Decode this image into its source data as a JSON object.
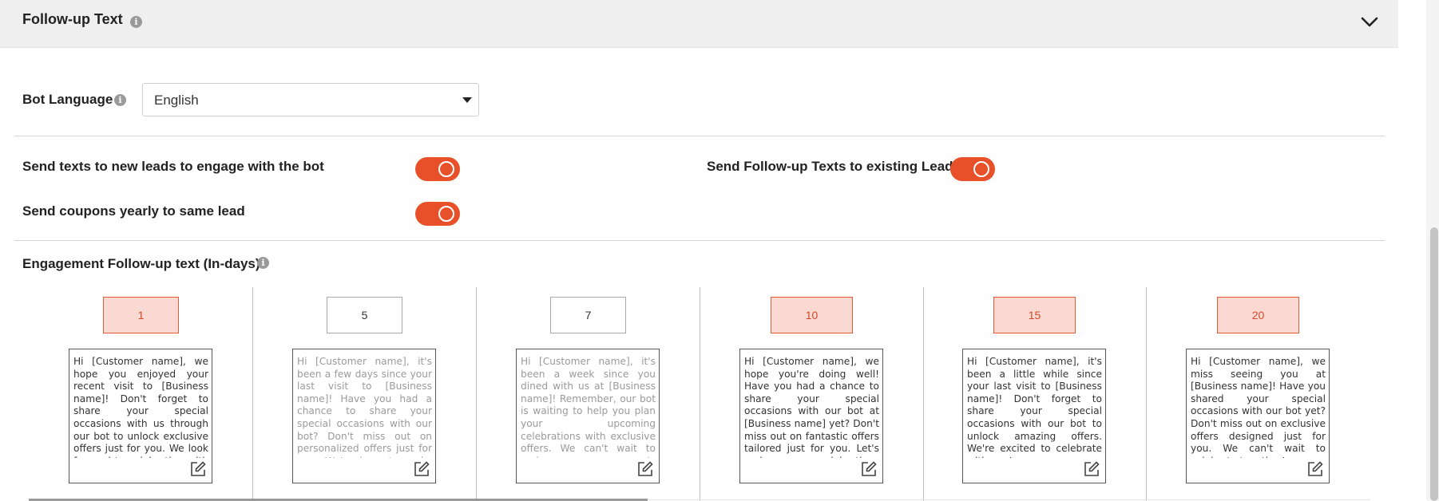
{
  "section": {
    "title": "Follow-up Text"
  },
  "bot_language": {
    "label": "Bot Language",
    "value": "English"
  },
  "toggles": {
    "new_leads": {
      "label": "Send texts to new leads to engage with the bot",
      "on": true
    },
    "coupons": {
      "label": "Send coupons yearly to same lead",
      "on": true
    },
    "existing_leads": {
      "label": "Send Follow-up Texts to existing Leads",
      "on": true
    }
  },
  "engagement": {
    "label": "Engagement Follow-up text (In-days)",
    "days": [
      {
        "day": "1",
        "highlighted": true,
        "dim": false,
        "text": "Hi [Customer name], we hope you enjoyed your recent visit to [Business name]! Don't forget to share your special occasions with us through our bot to unlock exclusive offers just for you. We look forward to celebrating with you!"
      },
      {
        "day": "5",
        "highlighted": false,
        "dim": true,
        "text": "Hi [Customer name], it's been a few days since your last visit to [Business name]! Have you had a chance to share your special occasions with our bot? Don't miss out on personalized offers just for you. We're here to make your moments special!"
      },
      {
        "day": "7",
        "highlighted": false,
        "dim": true,
        "text": "Hi [Customer name], it's been a week since you dined with us at [Business name]! Remember, our bot is waiting to help you plan your upcoming celebrations with exclusive offers. We can't wait to make your moments memorable!"
      },
      {
        "day": "10",
        "highlighted": true,
        "dim": false,
        "text": "Hi [Customer name], we hope you're doing well! Have you had a chance to share your special occasions with our bot at [Business name] yet? Don't miss out on fantastic offers tailored just for you. Let's make your celebrations unforgettable!"
      },
      {
        "day": "15",
        "highlighted": true,
        "dim": false,
        "text": "Hi [Customer name], it's been a little while since your last visit to [Business name]! Don't forget to share your special occasions with our bot to unlock amazing offers. We're excited to celebrate with you!"
      },
      {
        "day": "20",
        "highlighted": true,
        "dim": false,
        "text": "Hi [Customer name], we miss seeing you at [Business name]! Have you shared your special occasions with our bot yet? Don't miss out on exclusive offers designed just for you. We can't wait to celebrate together!"
      }
    ]
  },
  "colors": {
    "accent": "#e8502a",
    "highlight_bg": "#f9d9d2",
    "highlight_border": "#e25c3a",
    "header_bg": "#efefef"
  },
  "icons": {
    "info": "info-icon",
    "chevron": "chevron-down-icon",
    "edit": "edit-icon"
  }
}
